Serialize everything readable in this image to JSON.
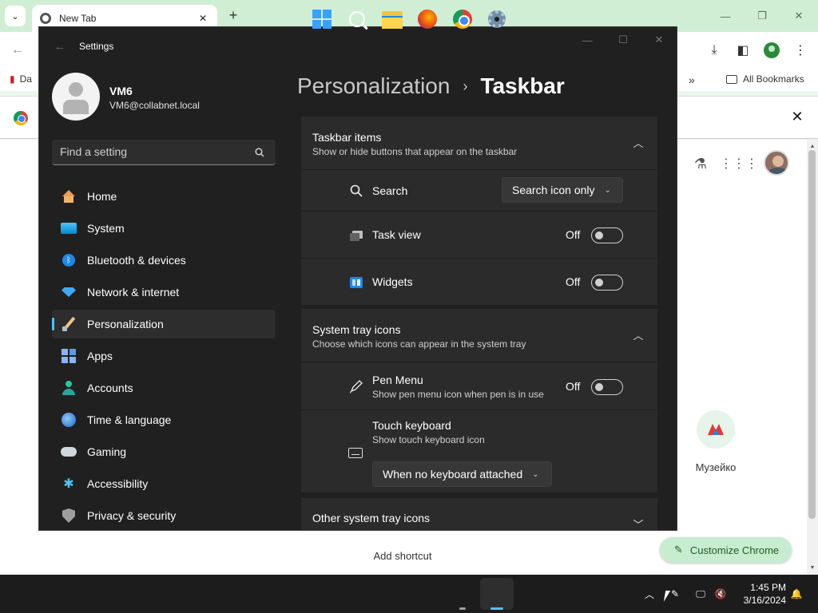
{
  "chrome": {
    "tab_title": "New Tab",
    "bookmarks": {
      "first_label": "Da",
      "all_bookmarks": "All Bookmarks"
    },
    "shortcut": {
      "label": "Музейко"
    },
    "add_shortcut": "Add shortcut",
    "customize_label": "Customize Chrome"
  },
  "settings": {
    "window_title": "Settings",
    "user": {
      "name": "VM6",
      "email": "VM6@collabnet.local"
    },
    "search": {
      "placeholder": "Find a setting"
    },
    "nav": [
      {
        "label": "Home",
        "icon": "home-icon"
      },
      {
        "label": "System",
        "icon": "system-icon"
      },
      {
        "label": "Bluetooth & devices",
        "icon": "bluetooth-icon"
      },
      {
        "label": "Network & internet",
        "icon": "wifi-icon"
      },
      {
        "label": "Personalization",
        "icon": "paintbrush-icon",
        "active": true
      },
      {
        "label": "Apps",
        "icon": "apps-icon"
      },
      {
        "label": "Accounts",
        "icon": "account-icon"
      },
      {
        "label": "Time & language",
        "icon": "globe-clock-icon"
      },
      {
        "label": "Gaming",
        "icon": "gamepad-icon"
      },
      {
        "label": "Accessibility",
        "icon": "accessibility-icon"
      },
      {
        "label": "Privacy & security",
        "icon": "shield-icon"
      }
    ],
    "breadcrumb": {
      "parent": "Personalization",
      "current": "Taskbar"
    },
    "taskbar_items": {
      "title": "Taskbar items",
      "subtitle": "Show or hide buttons that appear on the taskbar",
      "search": {
        "label": "Search",
        "value": "Search icon only"
      },
      "task_view": {
        "label": "Task view",
        "state": "Off"
      },
      "widgets": {
        "label": "Widgets",
        "state": "Off"
      }
    },
    "system_tray": {
      "title": "System tray icons",
      "subtitle": "Choose which icons can appear in the system tray",
      "pen_menu": {
        "label": "Pen Menu",
        "sub": "Show pen menu icon when pen is in use",
        "state": "Off"
      },
      "touch_keyboard": {
        "label": "Touch keyboard",
        "sub": "Show touch keyboard icon",
        "value": "When no keyboard attached"
      }
    },
    "other_tray": {
      "title": "Other system tray icons"
    }
  },
  "taskbar": {
    "time": "1:45 PM",
    "date": "3/16/2024"
  },
  "colors": {
    "accent": "#4cc2ff",
    "chrome_accent": "#cfeed4"
  }
}
